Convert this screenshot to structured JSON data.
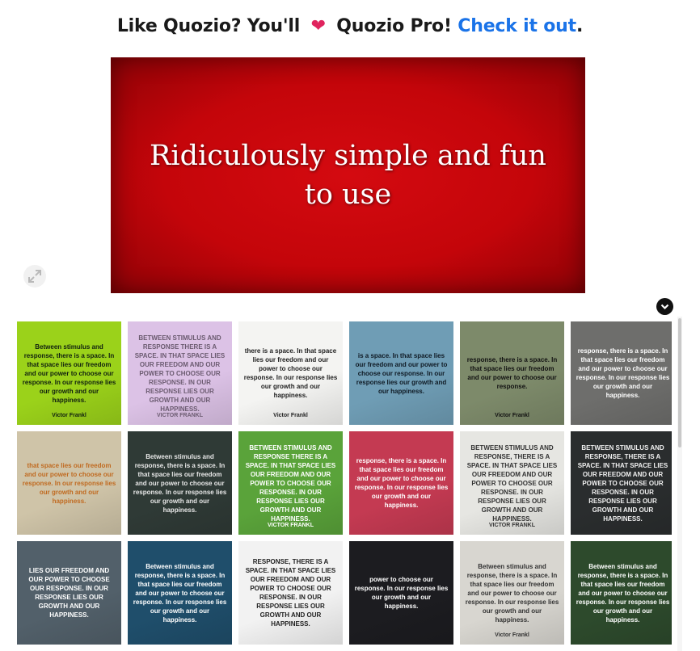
{
  "promo": {
    "prefix": "Like Quozio? You'll",
    "heart": "❤",
    "product": "Quozio Pro!",
    "link": "Check it out",
    "suffix": "."
  },
  "hero": {
    "text": "Ridiculously simple and fun to use",
    "background": "#c4050a"
  },
  "icons": {
    "expand": "expand-icon",
    "chevron": "chevron-down-icon"
  },
  "gallery": {
    "tiles": [
      {
        "text": "Between stimulus and response, there is a space. In that space lies our freedom and our power to choose our response. In our response lies our growth and our happiness.",
        "author": "Victor Frankl",
        "bg": "#9bd21a",
        "fg": "#102010"
      },
      {
        "text": "BETWEEN STIMULUS AND RESPONSE THERE IS A SPACE. IN THAT SPACE LIES OUR FREEDOM AND OUR POWER TO CHOOSE OUR RESPONSE. IN OUR RESPONSE LIES OUR GROWTH AND OUR HAPPINESS.",
        "author": "VICTOR FRANKL",
        "bg": "#dcc2e6",
        "fg": "#6b5b70"
      },
      {
        "text": "there is a space. In that space lies our freedom and our power to choose our response. In our response lies our growth and our happiness.",
        "author": "Victor Frankl",
        "bg": "#f4f4f2",
        "fg": "#222222"
      },
      {
        "text": "is a space. In that space lies our freedom and our power to choose our response. In our response lies our growth and our happiness.",
        "author": "",
        "bg": "#6f9db5",
        "fg": "#0f1a24"
      },
      {
        "text": "response, there is a space. In that space lies our freedom and our power to choose our response.",
        "author": "Victor Frankl",
        "bg": "#7d8a6a",
        "fg": "#111111"
      },
      {
        "text": "response, there is a space. In that space lies our freedom and our power to choose our response. In our response lies our growth and our happiness.",
        "author": "",
        "bg": "#6e6e6c",
        "fg": "#ffffff"
      },
      {
        "text": "that space lies our freedom and our power to choose our response. In our response lies our growth and our happiness.",
        "author": "",
        "bg": "#cfc4a8",
        "fg": "#c06a20"
      },
      {
        "text": "Between stimulus and response, there is a space. In that space lies our freedom and our power to choose our response. In our response lies our growth and our happiness.",
        "author": "",
        "bg": "#2f3a36",
        "fg": "#e8e8e8"
      },
      {
        "text": "BETWEEN STIMULUS AND RESPONSE THERE IS A SPACE. IN THAT SPACE LIES OUR FREEDOM AND OUR POWER TO CHOOSE OUR RESPONSE. IN OUR RESPONSE LIES OUR GROWTH AND OUR HAPPINESS.",
        "author": "VICTOR FRANKL",
        "bg": "#5aa33a",
        "fg": "#ffffff"
      },
      {
        "text": "response, there is a space. In that space lies our freedom and our power to choose our response. In our response lies our growth and our happiness.",
        "author": "",
        "bg": "#c43a52",
        "fg": "#ffffff"
      },
      {
        "text": "BETWEEN STIMULUS AND RESPONSE, THERE IS A SPACE. IN THAT SPACE LIES OUR FREEDOM AND OUR POWER TO CHOOSE OUR RESPONSE. IN OUR RESPONSE LIES OUR GROWTH AND OUR HAPPINESS.",
        "author": "VICTOR FRANKL",
        "bg": "#e6e6e2",
        "fg": "#333333"
      },
      {
        "text": "BETWEEN STIMULUS AND RESPONSE, THERE IS A SPACE. IN THAT SPACE LIES OUR FREEDOM AND OUR POWER TO CHOOSE OUR RESPONSE. IN OUR RESPONSE LIES OUR GROWTH AND OUR HAPPINESS.",
        "author": "",
        "bg": "#2a2d2e",
        "fg": "#f0f0f0"
      },
      {
        "text": "LIES OUR FREEDOM AND OUR POWER TO CHOOSE OUR RESPONSE. IN OUR RESPONSE LIES OUR GROWTH AND OUR HAPPINESS.",
        "author": "",
        "bg": "#52606a",
        "fg": "#ffffff"
      },
      {
        "text": "Between stimulus and response, there is a space. In that space lies our freedom and our power to choose our response. In our response lies our growth and our happiness.",
        "author": "",
        "bg": "#1f4e6b",
        "fg": "#ffffff"
      },
      {
        "text": "RESPONSE, THERE IS A SPACE. IN THAT SPACE LIES OUR FREEDOM AND OUR POWER TO CHOOSE OUR RESPONSE. IN OUR RESPONSE LIES OUR GROWTH AND OUR HAPPINESS.",
        "author": "",
        "bg": "#f2f2f2",
        "fg": "#222222"
      },
      {
        "text": "power to choose our response. In our response lies our growth and our happiness.",
        "author": "",
        "bg": "#1c1c20",
        "fg": "#ffffff"
      },
      {
        "text": "Between stimulus and response, there is a space. In that space lies our freedom and our power to choose our response. In our response lies our growth and our happiness.",
        "author": "Victor Frankl",
        "bg": "#d8d6d0",
        "fg": "#333333"
      },
      {
        "text": "Between stimulus and response, there is a space. In that space lies our freedom and our power to choose our response. In our response lies our growth and our happiness.",
        "author": "",
        "bg": "#2d4a2c",
        "fg": "#ffffff"
      }
    ]
  }
}
